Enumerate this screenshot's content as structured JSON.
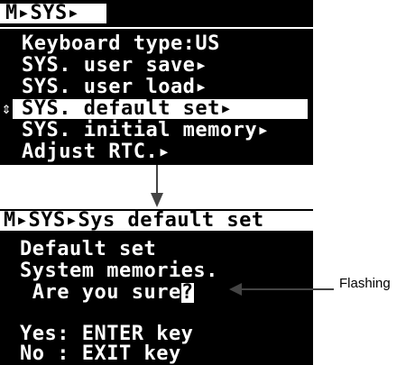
{
  "screen1": {
    "breadcrumb": "M▸SYS▸",
    "items": [
      "Keyboard type:US",
      "SYS. user save▸",
      "SYS. user load▸",
      "SYS. default set▸",
      "SYS. initial memory▸",
      "Adjust RTC.▸"
    ],
    "cursor": "⇕"
  },
  "screen2": {
    "breadcrumb": "M▸SYS▸Sys default set",
    "lines": [
      "Default set",
      "System memories.",
      " Are you sure",
      "",
      "Yes: ENTER key",
      "No : EXIT key"
    ],
    "cursor_char": "?"
  },
  "callout": {
    "label": "Flashing"
  },
  "colors": {
    "lcd_bg": "#000000",
    "lcd_fg": "#ffffff"
  }
}
